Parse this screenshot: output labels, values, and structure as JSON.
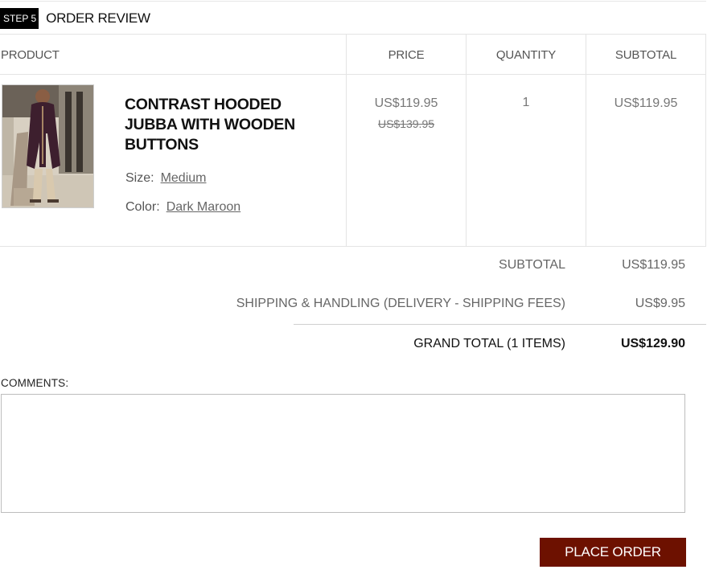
{
  "step": {
    "badge": "STEP 5",
    "title": "ORDER REVIEW"
  },
  "table": {
    "headers": {
      "product": "PRODUCT",
      "price": "PRICE",
      "quantity": "QUANTITY",
      "subtotal": "SUBTOTAL"
    },
    "item": {
      "name": "CONTRAST HOODED JUBBA WITH WOODEN BUTTONS",
      "size_label": "Size:",
      "size_value": "Medium",
      "color_label": "Color:",
      "color_value": "Dark Maroon",
      "price": "US$119.95",
      "original_price": "US$139.95",
      "quantity": "1",
      "subtotal": "US$119.95"
    }
  },
  "totals": {
    "subtotal_label": "SUBTOTAL",
    "subtotal_value": "US$119.95",
    "shipping_label": "SHIPPING & HANDLING (DELIVERY - SHIPPING FEES)",
    "shipping_value": "US$9.95",
    "grand_label": "GRAND TOTAL (1 ITEMS)",
    "grand_value": "US$129.90"
  },
  "comments": {
    "label": "COMMENTS:",
    "value": ""
  },
  "actions": {
    "place_order": "PLACE ORDER"
  },
  "colors": {
    "accent": "#6d1100",
    "badge_bg": "#000000",
    "product_color": "#3d1f2e"
  }
}
